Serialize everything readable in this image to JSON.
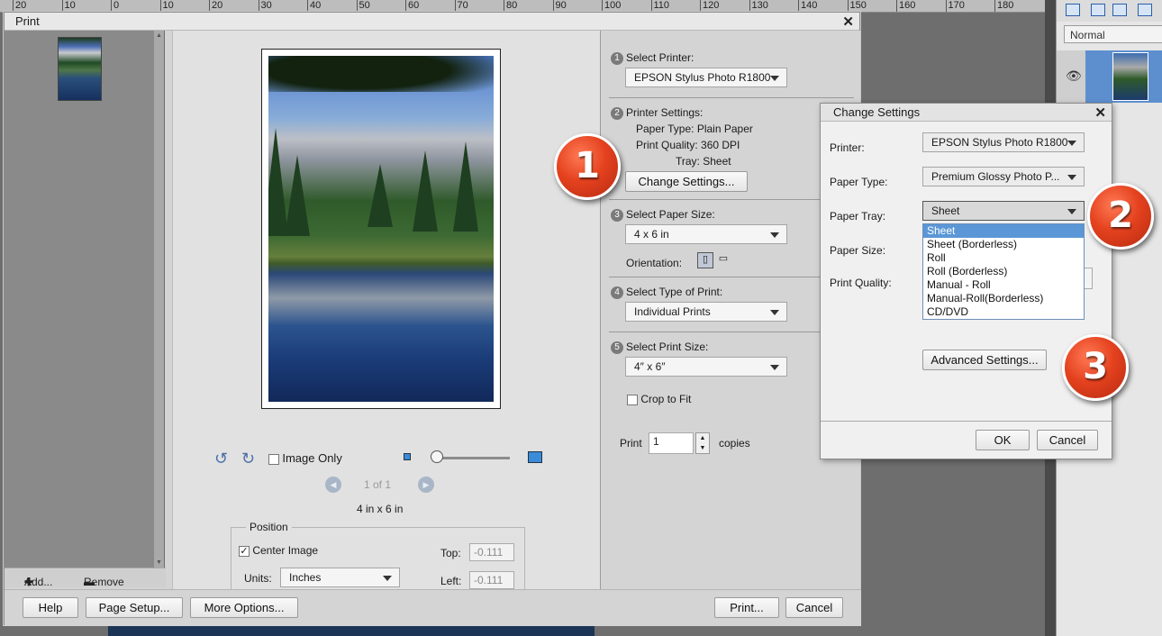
{
  "ruler": [
    "20",
    "10",
    "0",
    "10",
    "20",
    "30",
    "40",
    "50",
    "60",
    "70",
    "80",
    "90",
    "100",
    "110",
    "120",
    "130",
    "140",
    "150",
    "160",
    "170",
    "180"
  ],
  "right_panel": {
    "blend_mode": "Normal"
  },
  "dialog": {
    "title": "Print",
    "add_label": "Add...",
    "remove_label": "Remove",
    "preview": {
      "image_only_label": "Image Only",
      "page_indicator": "1 of 1",
      "size_text": "4 in x 6 in",
      "position_legend": "Position",
      "center_image_label": "Center Image",
      "center_image_checked": true,
      "top_label": "Top:",
      "top_value": "-0.111",
      "left_label": "Left:",
      "left_value": "-0.111",
      "units_label": "Units:",
      "units_value": "Inches"
    },
    "steps": {
      "s1_label": "Select Printer:",
      "printer": "EPSON Stylus Photo R1800",
      "s2_label": "Printer Settings:",
      "paper_type_line": "Paper Type:  Plain Paper",
      "print_quality_line": "Print Quality:  360 DPI",
      "tray_line": "Tray:  Sheet",
      "change_settings": "Change Settings...",
      "s3_label": "Select Paper Size:",
      "paper_size": "4 x 6 in",
      "orientation_label": "Orientation:",
      "s4_label": "Select Type of Print:",
      "print_type": "Individual Prints",
      "s5_label": "Select Print Size:",
      "print_size": "4″ x 6″",
      "crop_label": "Crop to Fit",
      "print_label": "Print",
      "copies_value": "1",
      "copies_label": "copies"
    },
    "footer": {
      "help": "Help",
      "page_setup": "Page Setup...",
      "more_options": "More Options...",
      "print": "Print...",
      "cancel": "Cancel"
    }
  },
  "change_settings": {
    "title": "Change Settings",
    "printer_label": "Printer:",
    "printer_value": "EPSON Stylus Photo R1800",
    "paper_type_label": "Paper Type:",
    "paper_type_value": "Premium Glossy Photo P...",
    "paper_tray_label": "Paper Tray:",
    "paper_tray_value": "Sheet",
    "paper_size_label": "Paper Size:",
    "print_quality_label": "Print Quality:",
    "tray_options": [
      "Sheet",
      "Sheet (Borderless)",
      "Roll",
      "Roll (Borderless)",
      "Manual - Roll",
      "Manual-Roll(Borderless)",
      "CD/DVD"
    ],
    "advanced": "Advanced Settings...",
    "ok": "OK",
    "cancel": "Cancel"
  },
  "badges": [
    "1",
    "2",
    "3"
  ],
  "colors": {
    "badge": "#e5421f",
    "selection": "#5b97d6"
  }
}
